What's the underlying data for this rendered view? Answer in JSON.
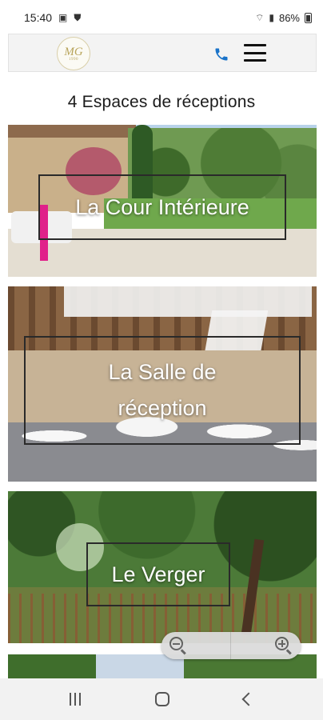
{
  "status_bar": {
    "time": "15:40",
    "battery": "86%",
    "icons": [
      "image-icon",
      "shield-icon",
      "wifi-icon",
      "signal-icon",
      "battery-icon"
    ]
  },
  "header": {
    "logo_text": "MG",
    "logo_subtext": "1990",
    "icons": [
      "phone-icon",
      "hamburger-menu-icon"
    ],
    "phone_color": "#1a73c9"
  },
  "main": {
    "title": "4 Espaces de réceptions",
    "venues": [
      {
        "label": "La Cour Intérieure"
      },
      {
        "label": "La Salle de réception"
      },
      {
        "label": "Le Verger"
      }
    ]
  },
  "zoom": {
    "icons": [
      "zoom-out-icon",
      "zoom-in-icon"
    ]
  },
  "nav_bar": {
    "icons": [
      "recent-apps-icon",
      "home-icon",
      "back-icon"
    ]
  }
}
